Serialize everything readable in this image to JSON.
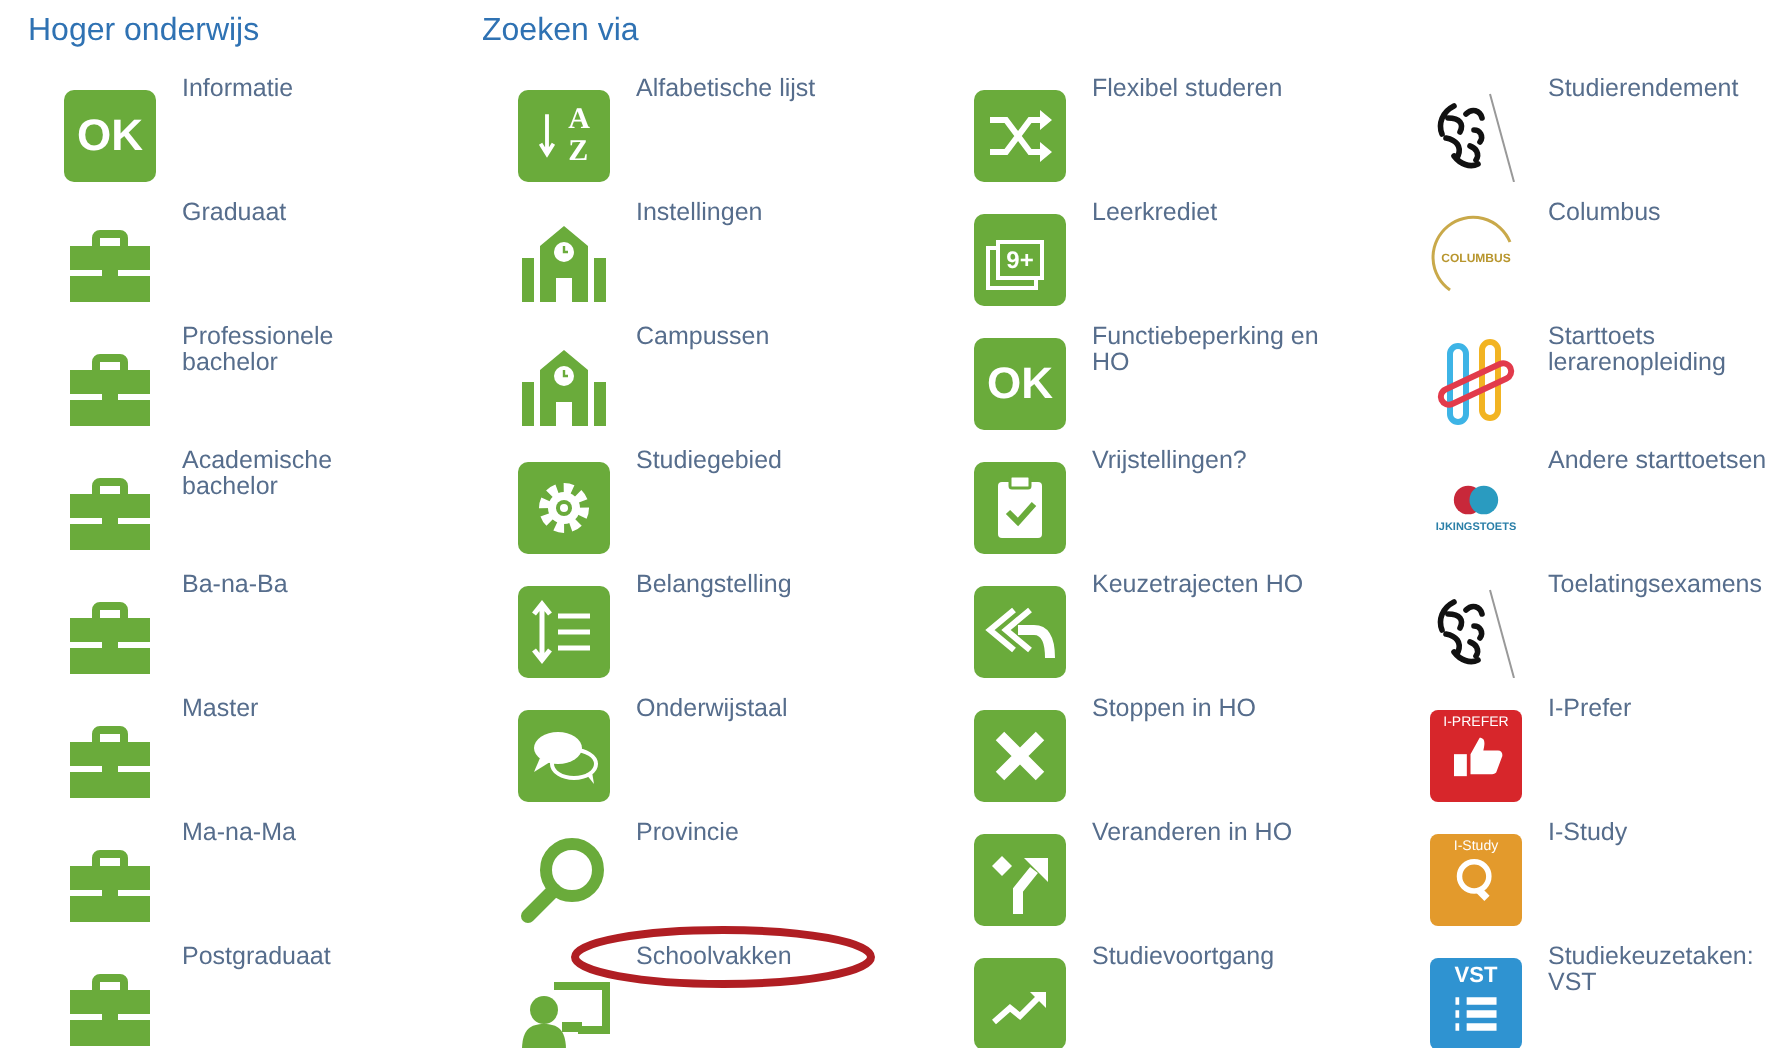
{
  "sections": [
    {
      "title": "Hoger onderwijs",
      "columns": [
        [
          {
            "label": "Informatie",
            "kind": "ok",
            "badge": "OK"
          },
          {
            "label": "Graduaat",
            "kind": "briefcase"
          },
          {
            "label": "Professionele bachelor",
            "kind": "briefcase"
          },
          {
            "label": "Academische bachelor",
            "kind": "briefcase"
          },
          {
            "label": "Ba-na-Ba",
            "kind": "briefcase"
          },
          {
            "label": "Master",
            "kind": "briefcase"
          },
          {
            "label": "Ma-na-Ma",
            "kind": "briefcase"
          },
          {
            "label": "Postgraduaat",
            "kind": "briefcase"
          }
        ]
      ]
    },
    {
      "title": "Zoeken via",
      "columns": [
        [
          {
            "label": "Alfabetische lijst",
            "kind": "az",
            "glyphs": [
              "A",
              "Z"
            ]
          },
          {
            "label": "Instellingen",
            "kind": "school"
          },
          {
            "label": "Campussen",
            "kind": "school"
          },
          {
            "label": "Studiegebied",
            "kind": "gear"
          },
          {
            "label": "Belangstelling",
            "kind": "sort"
          },
          {
            "label": "Onderwijstaal",
            "kind": "chat"
          },
          {
            "label": "Provincie",
            "kind": "search"
          },
          {
            "label": "Schoolvakken",
            "kind": "teacher",
            "circled": true
          }
        ],
        [
          {
            "label": "Flexibel studeren",
            "kind": "shuffle"
          },
          {
            "label": "Leerkrediet",
            "kind": "stack",
            "badge": "9+"
          },
          {
            "label": "Functiebeperking en HO",
            "kind": "ok",
            "badge": "OK"
          },
          {
            "label": "Vrijstellingen?",
            "kind": "clipboard"
          },
          {
            "label": "Keuzetrajecten HO",
            "kind": "replyall"
          },
          {
            "label": "Stoppen in HO",
            "kind": "cross"
          },
          {
            "label": "Veranderen in HO",
            "kind": "fork"
          },
          {
            "label": "Studievoortgang",
            "kind": "trend"
          }
        ],
        [
          {
            "label": "Studierendement",
            "kind": "lion"
          },
          {
            "label": "Columbus",
            "kind": "columbus",
            "badge": "COLUMBUS"
          },
          {
            "label": "Starttoets lerarenopleiding",
            "kind": "clips"
          },
          {
            "label": "Andere starttoetsen",
            "kind": "rings",
            "badge": "IJKINGSTOETS"
          },
          {
            "label": "Toelatingsexamens",
            "kind": "lion"
          },
          {
            "label": "I-Prefer",
            "kind": "thumb",
            "badge": "I-PREFER"
          },
          {
            "label": "I-Study",
            "kind": "bulb",
            "badge": "I-Study"
          },
          {
            "label": "Studiekeuzetaken: VST",
            "kind": "list",
            "badge": "VST"
          }
        ]
      ]
    }
  ]
}
